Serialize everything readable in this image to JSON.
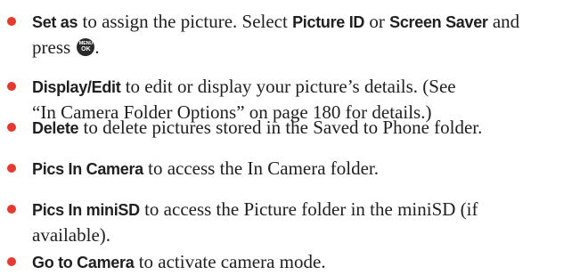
{
  "items": [
    {
      "id": "set-as",
      "parts": [
        {
          "t": "key",
          "v": "Set as"
        },
        {
          "t": "text",
          "v": " to assign the picture. Select "
        },
        {
          "t": "key",
          "v": "Picture ID"
        },
        {
          "t": "text",
          "v": " or "
        },
        {
          "t": "key",
          "v": "Screen Saver"
        },
        {
          "t": "text",
          "v": " and"
        },
        {
          "t": "br"
        },
        {
          "t": "text",
          "v": "press "
        },
        {
          "t": "icon",
          "v": "MENU",
          "v2": "OK"
        },
        {
          "t": "text",
          "v": "."
        }
      ]
    },
    {
      "id": "display-edit",
      "parts": [
        {
          "t": "key",
          "v": "Display/Edit"
        },
        {
          "t": "text",
          "v": " to edit or display your picture’s details. (See"
        },
        {
          "t": "br"
        },
        {
          "t": "text",
          "v": "“In Camera Folder Options” on page 180 for details.)"
        }
      ]
    },
    {
      "id": "delete",
      "parts": [
        {
          "t": "key",
          "v": "Delete"
        },
        {
          "t": "text",
          "v": " to delete pictures stored in the Saved to Phone folder."
        }
      ]
    },
    {
      "id": "pics-in-camera",
      "parts": [
        {
          "t": "key",
          "v": "Pics In Camera"
        },
        {
          "t": "text",
          "v": " to access the In Camera folder."
        }
      ]
    },
    {
      "id": "pics-in-minisd",
      "parts": [
        {
          "t": "key",
          "v": "Pics In miniSD"
        },
        {
          "t": "text",
          "v": " to access the Picture folder in the miniSD (if"
        },
        {
          "t": "br"
        },
        {
          "t": "text",
          "v": "available)."
        }
      ]
    },
    {
      "id": "go-to-camera",
      "parts": [
        {
          "t": "key",
          "v": "Go to Camera"
        },
        {
          "t": "text",
          "v": " to activate camera mode."
        }
      ]
    }
  ],
  "colors": {
    "bullet": "#e53a2f",
    "text": "#1f1f1f",
    "key_icon_bg": "#2a2a2a"
  },
  "icons": {
    "menu_ok": "menu-ok-key-icon",
    "bullet": "bullet-icon"
  }
}
